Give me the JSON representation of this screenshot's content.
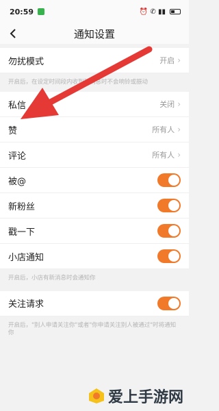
{
  "status_bar": {
    "time": "20:59",
    "right": "⏰ ✆ ▮▮"
  },
  "header": {
    "title": "通知设置"
  },
  "rows": {
    "dnd": {
      "label": "勿扰模式",
      "value": "开启"
    },
    "dnd_hint": "开启后，在设定时间段内收到新消息时不会响铃或振动",
    "pm": {
      "label": "私信",
      "value": "关闭"
    },
    "likes": {
      "label": "赞",
      "value": "所有人"
    },
    "comments": {
      "label": "评论",
      "value": "所有人"
    },
    "mention": {
      "label": "被@"
    },
    "fans": {
      "label": "新粉丝"
    },
    "poke": {
      "label": "戳一下"
    },
    "shop": {
      "label": "小店通知"
    },
    "shop_hint": "开启后，小店有新消息时会通知你",
    "follow_req": {
      "label": "关注请求"
    },
    "follow_hint": "开启后，\"别人申请关注你\"或者\"你申请关注别人被通过\"时将通知你"
  },
  "watermark": {
    "text": "爱上手游网"
  },
  "colors": {
    "accent": "#f07a2a",
    "arrow": "#e53935"
  }
}
